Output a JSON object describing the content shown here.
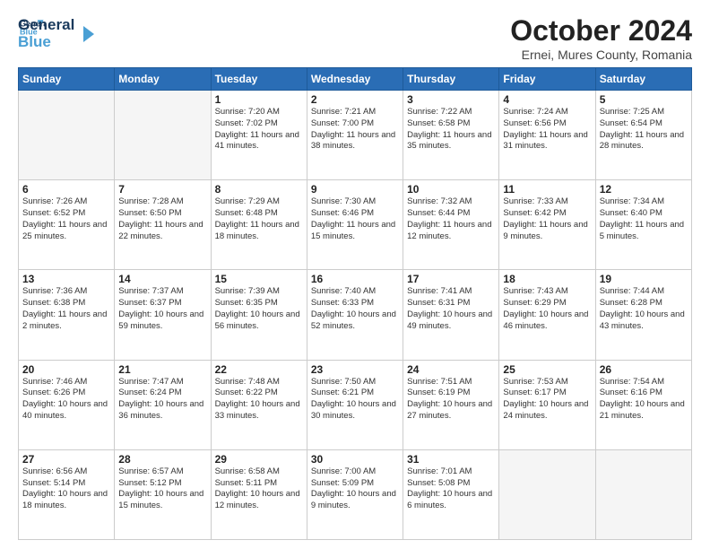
{
  "header": {
    "logo_line1": "General",
    "logo_line2": "Blue",
    "month": "October 2024",
    "location": "Ernei, Mures County, Romania"
  },
  "weekdays": [
    "Sunday",
    "Monday",
    "Tuesday",
    "Wednesday",
    "Thursday",
    "Friday",
    "Saturday"
  ],
  "weeks": [
    [
      {
        "day": "",
        "info": ""
      },
      {
        "day": "",
        "info": ""
      },
      {
        "day": "1",
        "info": "Sunrise: 7:20 AM\nSunset: 7:02 PM\nDaylight: 11 hours\nand 41 minutes."
      },
      {
        "day": "2",
        "info": "Sunrise: 7:21 AM\nSunset: 7:00 PM\nDaylight: 11 hours\nand 38 minutes."
      },
      {
        "day": "3",
        "info": "Sunrise: 7:22 AM\nSunset: 6:58 PM\nDaylight: 11 hours\nand 35 minutes."
      },
      {
        "day": "4",
        "info": "Sunrise: 7:24 AM\nSunset: 6:56 PM\nDaylight: 11 hours\nand 31 minutes."
      },
      {
        "day": "5",
        "info": "Sunrise: 7:25 AM\nSunset: 6:54 PM\nDaylight: 11 hours\nand 28 minutes."
      }
    ],
    [
      {
        "day": "6",
        "info": "Sunrise: 7:26 AM\nSunset: 6:52 PM\nDaylight: 11 hours\nand 25 minutes."
      },
      {
        "day": "7",
        "info": "Sunrise: 7:28 AM\nSunset: 6:50 PM\nDaylight: 11 hours\nand 22 minutes."
      },
      {
        "day": "8",
        "info": "Sunrise: 7:29 AM\nSunset: 6:48 PM\nDaylight: 11 hours\nand 18 minutes."
      },
      {
        "day": "9",
        "info": "Sunrise: 7:30 AM\nSunset: 6:46 PM\nDaylight: 11 hours\nand 15 minutes."
      },
      {
        "day": "10",
        "info": "Sunrise: 7:32 AM\nSunset: 6:44 PM\nDaylight: 11 hours\nand 12 minutes."
      },
      {
        "day": "11",
        "info": "Sunrise: 7:33 AM\nSunset: 6:42 PM\nDaylight: 11 hours\nand 9 minutes."
      },
      {
        "day": "12",
        "info": "Sunrise: 7:34 AM\nSunset: 6:40 PM\nDaylight: 11 hours\nand 5 minutes."
      }
    ],
    [
      {
        "day": "13",
        "info": "Sunrise: 7:36 AM\nSunset: 6:38 PM\nDaylight: 11 hours\nand 2 minutes."
      },
      {
        "day": "14",
        "info": "Sunrise: 7:37 AM\nSunset: 6:37 PM\nDaylight: 10 hours\nand 59 minutes."
      },
      {
        "day": "15",
        "info": "Sunrise: 7:39 AM\nSunset: 6:35 PM\nDaylight: 10 hours\nand 56 minutes."
      },
      {
        "day": "16",
        "info": "Sunrise: 7:40 AM\nSunset: 6:33 PM\nDaylight: 10 hours\nand 52 minutes."
      },
      {
        "day": "17",
        "info": "Sunrise: 7:41 AM\nSunset: 6:31 PM\nDaylight: 10 hours\nand 49 minutes."
      },
      {
        "day": "18",
        "info": "Sunrise: 7:43 AM\nSunset: 6:29 PM\nDaylight: 10 hours\nand 46 minutes."
      },
      {
        "day": "19",
        "info": "Sunrise: 7:44 AM\nSunset: 6:28 PM\nDaylight: 10 hours\nand 43 minutes."
      }
    ],
    [
      {
        "day": "20",
        "info": "Sunrise: 7:46 AM\nSunset: 6:26 PM\nDaylight: 10 hours\nand 40 minutes."
      },
      {
        "day": "21",
        "info": "Sunrise: 7:47 AM\nSunset: 6:24 PM\nDaylight: 10 hours\nand 36 minutes."
      },
      {
        "day": "22",
        "info": "Sunrise: 7:48 AM\nSunset: 6:22 PM\nDaylight: 10 hours\nand 33 minutes."
      },
      {
        "day": "23",
        "info": "Sunrise: 7:50 AM\nSunset: 6:21 PM\nDaylight: 10 hours\nand 30 minutes."
      },
      {
        "day": "24",
        "info": "Sunrise: 7:51 AM\nSunset: 6:19 PM\nDaylight: 10 hours\nand 27 minutes."
      },
      {
        "day": "25",
        "info": "Sunrise: 7:53 AM\nSunset: 6:17 PM\nDaylight: 10 hours\nand 24 minutes."
      },
      {
        "day": "26",
        "info": "Sunrise: 7:54 AM\nSunset: 6:16 PM\nDaylight: 10 hours\nand 21 minutes."
      }
    ],
    [
      {
        "day": "27",
        "info": "Sunrise: 6:56 AM\nSunset: 5:14 PM\nDaylight: 10 hours\nand 18 minutes."
      },
      {
        "day": "28",
        "info": "Sunrise: 6:57 AM\nSunset: 5:12 PM\nDaylight: 10 hours\nand 15 minutes."
      },
      {
        "day": "29",
        "info": "Sunrise: 6:58 AM\nSunset: 5:11 PM\nDaylight: 10 hours\nand 12 minutes."
      },
      {
        "day": "30",
        "info": "Sunrise: 7:00 AM\nSunset: 5:09 PM\nDaylight: 10 hours\nand 9 minutes."
      },
      {
        "day": "31",
        "info": "Sunrise: 7:01 AM\nSunset: 5:08 PM\nDaylight: 10 hours\nand 6 minutes."
      },
      {
        "day": "",
        "info": ""
      },
      {
        "day": "",
        "info": ""
      }
    ]
  ]
}
